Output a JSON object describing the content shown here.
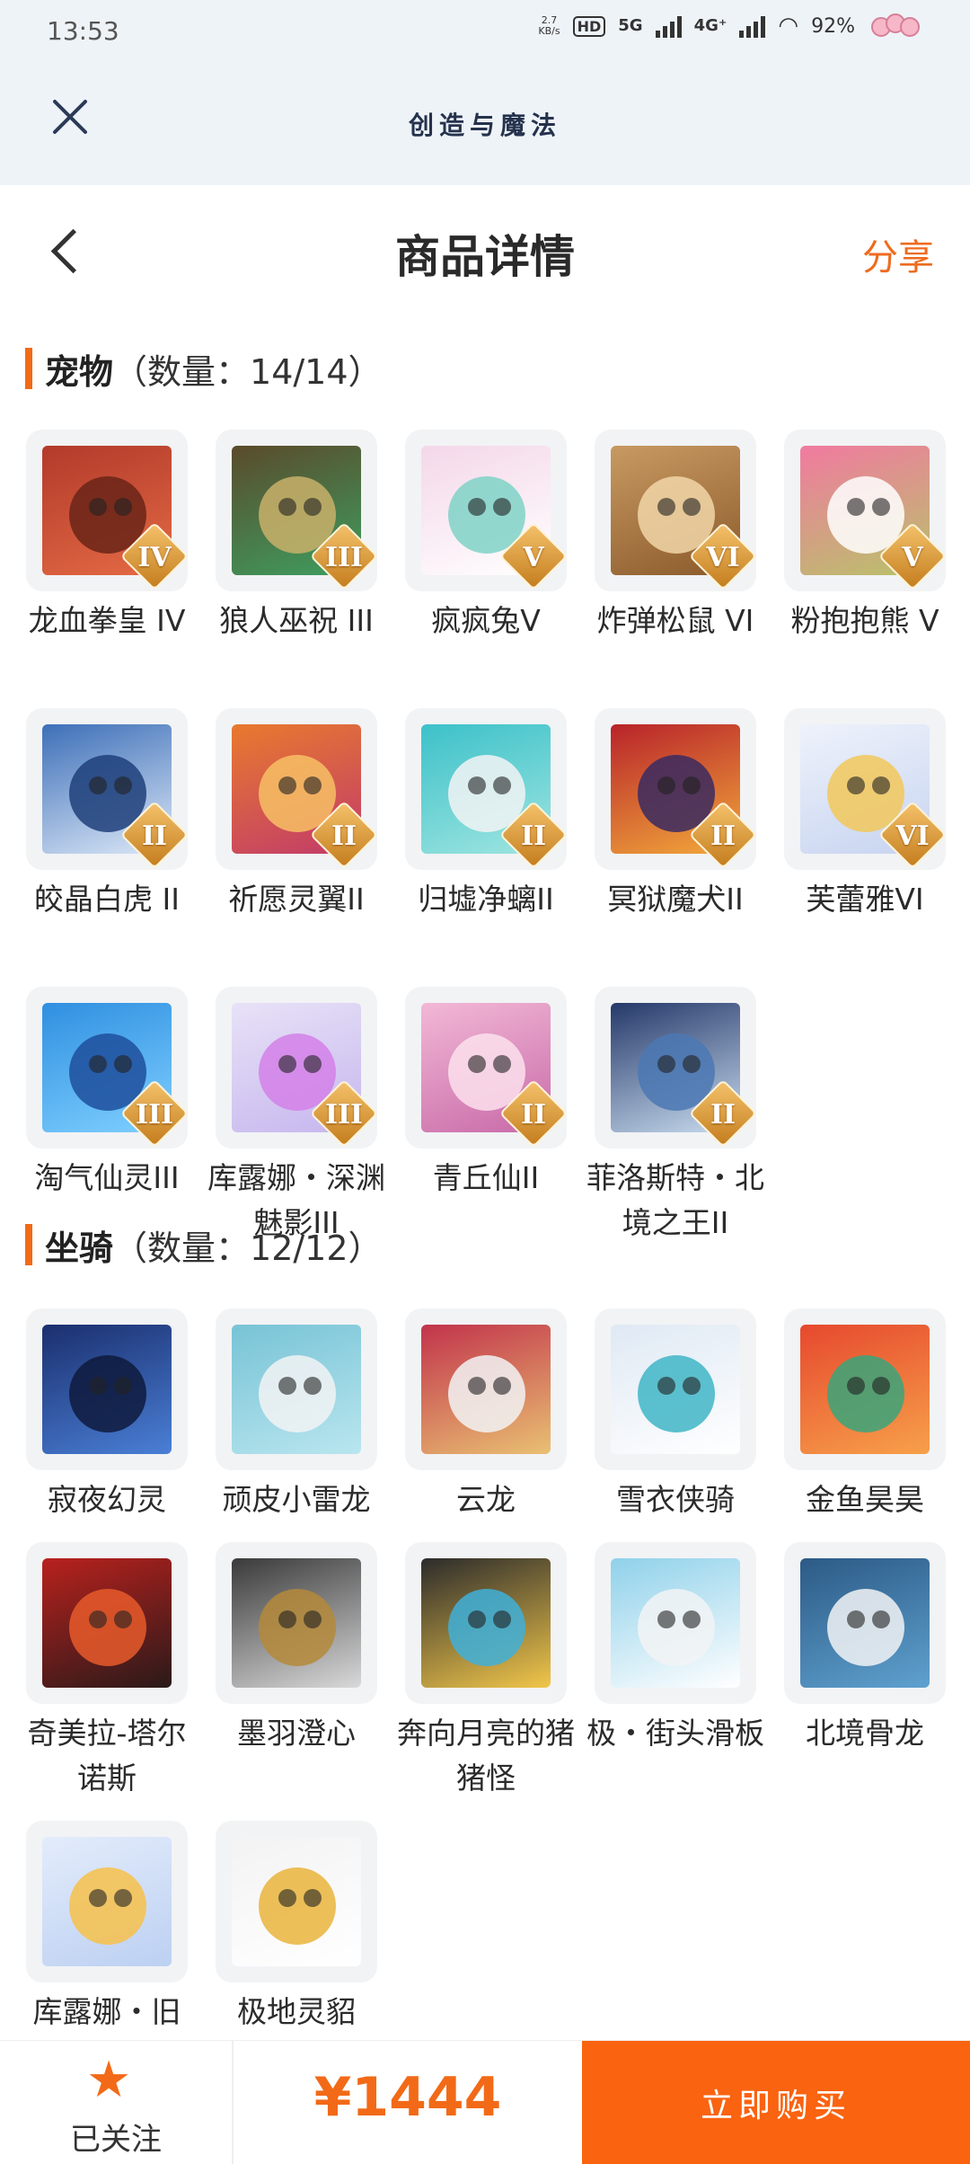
{
  "status": {
    "time": "13:53",
    "net_speed": "2.7",
    "net_speed_unit": "KB/s",
    "hd": "HD",
    "net1": "5G",
    "net2": "4G⁺",
    "battery": "92%"
  },
  "appbar": {
    "title": "创造与魔法"
  },
  "header": {
    "title": "商品详情",
    "share": "分享"
  },
  "pets": {
    "name": "宠物",
    "count": "（数量：14/14）",
    "items": [
      {
        "label": "龙血拳皇 IV",
        "badge": "IV",
        "colors": [
          "#b23a2a",
          "#e46a45",
          "#6a2418"
        ]
      },
      {
        "label": "狼人巫祝 III",
        "badge": "III",
        "colors": [
          "#5a4a2b",
          "#3e9e60",
          "#c9b06a"
        ]
      },
      {
        "label": "疯疯兔V",
        "badge": "V",
        "colors": [
          "#f4d7e9",
          "#ffffff",
          "#7fd2c7"
        ]
      },
      {
        "label": "炸弹松鼠 VI",
        "badge": "VI",
        "colors": [
          "#c89a62",
          "#8b5a2b",
          "#f1d6a8"
        ]
      },
      {
        "label": "粉抱抱熊 V",
        "badge": "V",
        "colors": [
          "#f17aa0",
          "#b8c26a",
          "#ffffff"
        ]
      },
      {
        "label": "皎晶白虎 II",
        "badge": "II",
        "colors": [
          "#3d6fb8",
          "#dce8f7",
          "#1f3f7a"
        ]
      },
      {
        "label": "祈愿灵翼II",
        "badge": "II",
        "colors": [
          "#e87a2e",
          "#c23b6a",
          "#f7c065"
        ]
      },
      {
        "label": "归墟净螭II",
        "badge": "II",
        "colors": [
          "#3cc1c9",
          "#9fe5e0",
          "#f2f3f5"
        ]
      },
      {
        "label": "冥狱魔犬II",
        "badge": "II",
        "colors": [
          "#b8232a",
          "#f2a93b",
          "#3a2a60"
        ]
      },
      {
        "label": "芙蕾雅VI",
        "badge": "VI",
        "colors": [
          "#eef2fb",
          "#c7d4f0",
          "#f2c85a"
        ]
      },
      {
        "label": "淘气仙灵III",
        "badge": "III",
        "colors": [
          "#2f8fe0",
          "#7fd0ff",
          "#1e4f9c"
        ]
      },
      {
        "label": "库露娜・深渊魅影III",
        "badge": "III",
        "colors": [
          "#e8e2f7",
          "#c6b6ee",
          "#d480e8"
        ]
      },
      {
        "label": "青丘仙II",
        "badge": "II",
        "colors": [
          "#f2b8d6",
          "#c86aa8",
          "#fbe0ec"
        ]
      },
      {
        "label": "菲洛斯特・北境之王II",
        "badge": "II",
        "colors": [
          "#25396a",
          "#c9dcef",
          "#4b78b4"
        ]
      }
    ]
  },
  "mounts": {
    "name": "坐骑",
    "count": "（数量：12/12）",
    "items": [
      {
        "label": "寂夜幻灵",
        "colors": [
          "#1b2f6e",
          "#4a7fd6",
          "#0e1a3d"
        ]
      },
      {
        "label": "顽皮小雷龙",
        "colors": [
          "#77c3d6",
          "#b9e6ef",
          "#f2f3f5"
        ]
      },
      {
        "label": "云龙",
        "colors": [
          "#c2334b",
          "#e9c072",
          "#f2f3f5"
        ]
      },
      {
        "label": "雪衣侠骑",
        "colors": [
          "#dfe9f4",
          "#ffffff",
          "#3fb5c6"
        ]
      },
      {
        "label": "金鱼昊昊",
        "colors": [
          "#e6492e",
          "#f7a04a",
          "#3aa57a"
        ]
      },
      {
        "label": "奇美拉-塔尔诺斯",
        "colors": [
          "#b8211d",
          "#2a1a1a",
          "#e85a2a"
        ]
      },
      {
        "label": "墨羽澄心",
        "colors": [
          "#3a3a3a",
          "#d9d9d9",
          "#b48a3a"
        ]
      },
      {
        "label": "奔向月亮的猪猪怪",
        "colors": [
          "#2b2b2b",
          "#f1c64a",
          "#3fb0d9"
        ]
      },
      {
        "label": "极・街头滑板",
        "colors": [
          "#8fd1ea",
          "#ffffff",
          "#f2f3f5"
        ]
      },
      {
        "label": "北境骨龙",
        "colors": [
          "#2c5a86",
          "#5fa1cf",
          "#f2f3f5"
        ]
      },
      {
        "label": "库露娜・旧",
        "colors": [
          "#e3ecfb",
          "#bcd0f2",
          "#f7c14a"
        ]
      },
      {
        "label": "极地灵貂",
        "colors": [
          "#f3f3f3",
          "#ffffff",
          "#e9b43c"
        ]
      }
    ]
  },
  "bottom": {
    "follow_label": "已关注",
    "price": "¥1444",
    "buy_label": "立即购买"
  },
  "theme": {
    "accent": "#f26a17",
    "buy": "#fa6310"
  }
}
